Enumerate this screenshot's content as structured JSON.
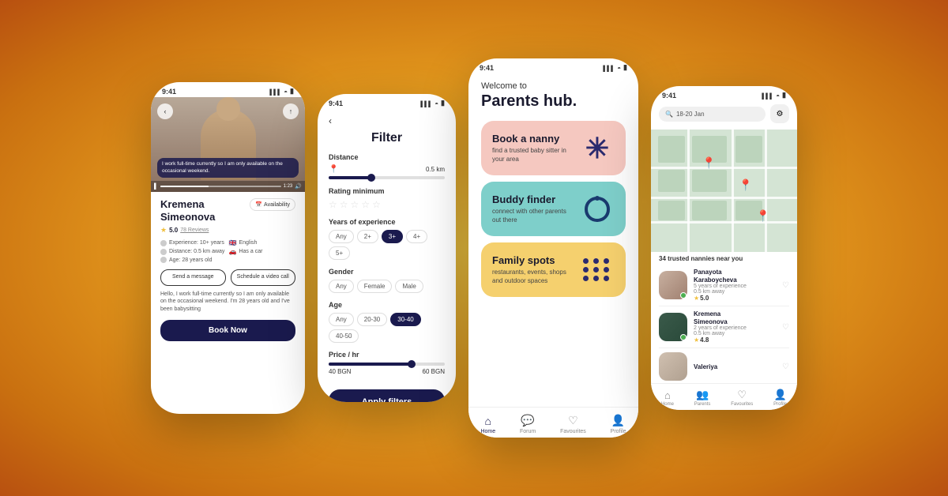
{
  "background": {
    "gradient": "radial orange-yellow"
  },
  "phone1": {
    "status_time": "9:41",
    "hero_quote": "I work full-time currently so I am only available on the occasional weekend.",
    "name": "Kremena Simeonova",
    "availability_label": "Availability",
    "rating": "5.0",
    "reviews": "78 Reviews",
    "experience": "Experience: 10+ years",
    "distance": "Distance: 0.5 km away",
    "age": "Age: 28 years old",
    "language": "English",
    "has_car": "Has a car",
    "send_message": "Send a message",
    "schedule_call": "Schedule a video call",
    "bio": "Hello, I work full-time currently so I am only available on the occasional weekend. I'm 28 years old and I've been babysitting",
    "book_btn": "Book Now"
  },
  "phone2": {
    "status_time": "9:41",
    "title": "Filter",
    "distance_label": "Distance",
    "distance_value": "0.5 km",
    "rating_label": "Rating minimum",
    "experience_label": "Years of experience",
    "experience_chips": [
      "Any",
      "2+",
      "3+",
      "4+",
      "5+"
    ],
    "gender_label": "Gender",
    "gender_chips": [
      "Any",
      "Female",
      "Male"
    ],
    "age_label": "Age",
    "age_chips": [
      "Any",
      "20-30",
      "30-40",
      "40-50"
    ],
    "price_label": "Price / hr",
    "price_min": "40 BGN",
    "price_max": "60 BGN",
    "apply_btn": "Apply filters"
  },
  "phone3": {
    "status_time": "9:41",
    "welcome_text": "Welcome to",
    "title": "Parents hub.",
    "card1_title": "Book a nanny",
    "card1_sub": "find a trusted baby sitter in your area",
    "card1_icon": "asterisk",
    "card2_title": "Buddy finder",
    "card2_sub": "connect with other parents out there",
    "card2_icon": "swirl",
    "card3_title": "Family spots",
    "card3_sub": "restaurants, events, shops and outdoor spaces",
    "card3_icon": "dots",
    "nav_home": "Home",
    "nav_forum": "Forum",
    "nav_favourites": "Favourites",
    "nav_profile": "Profile"
  },
  "phone4": {
    "status_time": "9:41",
    "search_placeholder": "18-20 Jan",
    "nannies_count": "34 trusted nannies near you",
    "nannies": [
      {
        "name": "Panayota Karaboycheva",
        "detail": "5 years of experience",
        "distance": "0.5 km away",
        "rating": "5.0",
        "online": true
      },
      {
        "name": "Kremena Simeonova",
        "detail": "2 years of experience",
        "distance": "0.5 km away",
        "rating": "4.8",
        "online": true
      },
      {
        "name": "Valeriya",
        "detail": "",
        "distance": "",
        "rating": "",
        "online": false
      }
    ],
    "nav_home": "Home",
    "nav_parents": "Parents",
    "nav_favourites": "Favourites",
    "nav_profile": "Profile"
  }
}
